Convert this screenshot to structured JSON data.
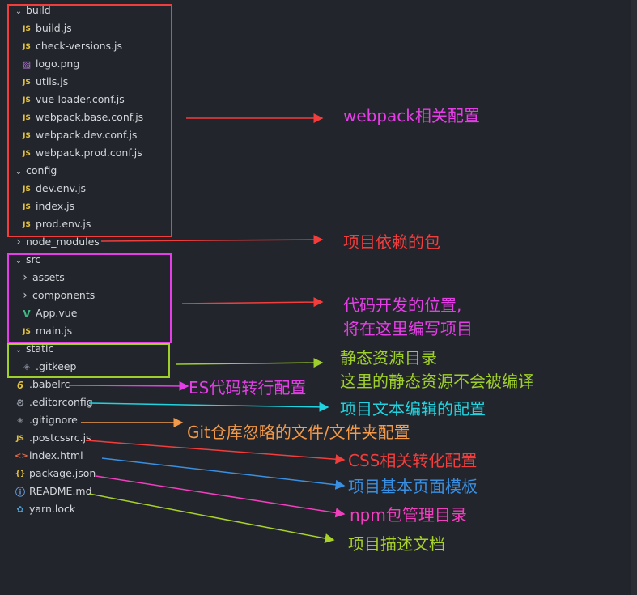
{
  "explorer": {
    "items": [
      {
        "name": "build",
        "type": "folder-open"
      },
      {
        "name": "build.js",
        "type": "js"
      },
      {
        "name": "check-versions.js",
        "type": "js"
      },
      {
        "name": "logo.png",
        "type": "png"
      },
      {
        "name": "utils.js",
        "type": "js"
      },
      {
        "name": "vue-loader.conf.js",
        "type": "js"
      },
      {
        "name": "webpack.base.conf.js",
        "type": "js"
      },
      {
        "name": "webpack.dev.conf.js",
        "type": "js"
      },
      {
        "name": "webpack.prod.conf.js",
        "type": "js"
      },
      {
        "name": "config",
        "type": "folder-open"
      },
      {
        "name": "dev.env.js",
        "type": "js"
      },
      {
        "name": "index.js",
        "type": "js"
      },
      {
        "name": "prod.env.js",
        "type": "js"
      },
      {
        "name": "node_modules",
        "type": "folder-closed"
      },
      {
        "name": "src",
        "type": "folder-open"
      },
      {
        "name": "assets",
        "type": "folder-closed"
      },
      {
        "name": "components",
        "type": "folder-closed"
      },
      {
        "name": "App.vue",
        "type": "vue"
      },
      {
        "name": "main.js",
        "type": "js"
      },
      {
        "name": "static",
        "type": "folder-open"
      },
      {
        "name": ".gitkeep",
        "type": "dot"
      },
      {
        "name": ".babelrc",
        "type": "babel"
      },
      {
        "name": ".editorconfig",
        "type": "gear"
      },
      {
        "name": ".gitignore",
        "type": "dot"
      },
      {
        "name": ".postcssrc.js",
        "type": "js"
      },
      {
        "name": "index.html",
        "type": "html"
      },
      {
        "name": "package.json",
        "type": "json"
      },
      {
        "name": "README.md",
        "type": "info"
      },
      {
        "name": "yarn.lock",
        "type": "yarn"
      }
    ],
    "icon_glyphs": {
      "js": "JS",
      "png": "▨",
      "vue": "V",
      "html": "<>",
      "json": "{}",
      "info": "ⓘ",
      "gear": "⚙",
      "dot": "◈",
      "babel": "6",
      "yarn": "✿"
    }
  },
  "annotations": {
    "webpack": "webpack相关配置",
    "node_modules": "项目依赖的包",
    "src_line1": "代码开发的位置,",
    "src_line2": "将在这里编写项目",
    "static_line1": "静态资源目录",
    "static_line2": "这里的静态资源不会被编译",
    "babelrc": "ES代码转行配置",
    "editorconfig": "项目文本编辑的配置",
    "gitignore": "Git仓库忽略的文件/文件夹配置",
    "postcssrc": "CSS相关转化配置",
    "index_html": "项目基本页面模板",
    "package_json": "npm包管理目录",
    "readme": "项目描述文档"
  },
  "colors": {
    "background": "#22252b",
    "red": "#f23d3d",
    "magenta": "#e43fe6",
    "green": "#9fcf2a",
    "cyan": "#1fd4e0",
    "orange": "#f2994a",
    "blue": "#3b8fe0",
    "pink": "#f23fbf",
    "yellowgreen": "#a8d22a"
  }
}
